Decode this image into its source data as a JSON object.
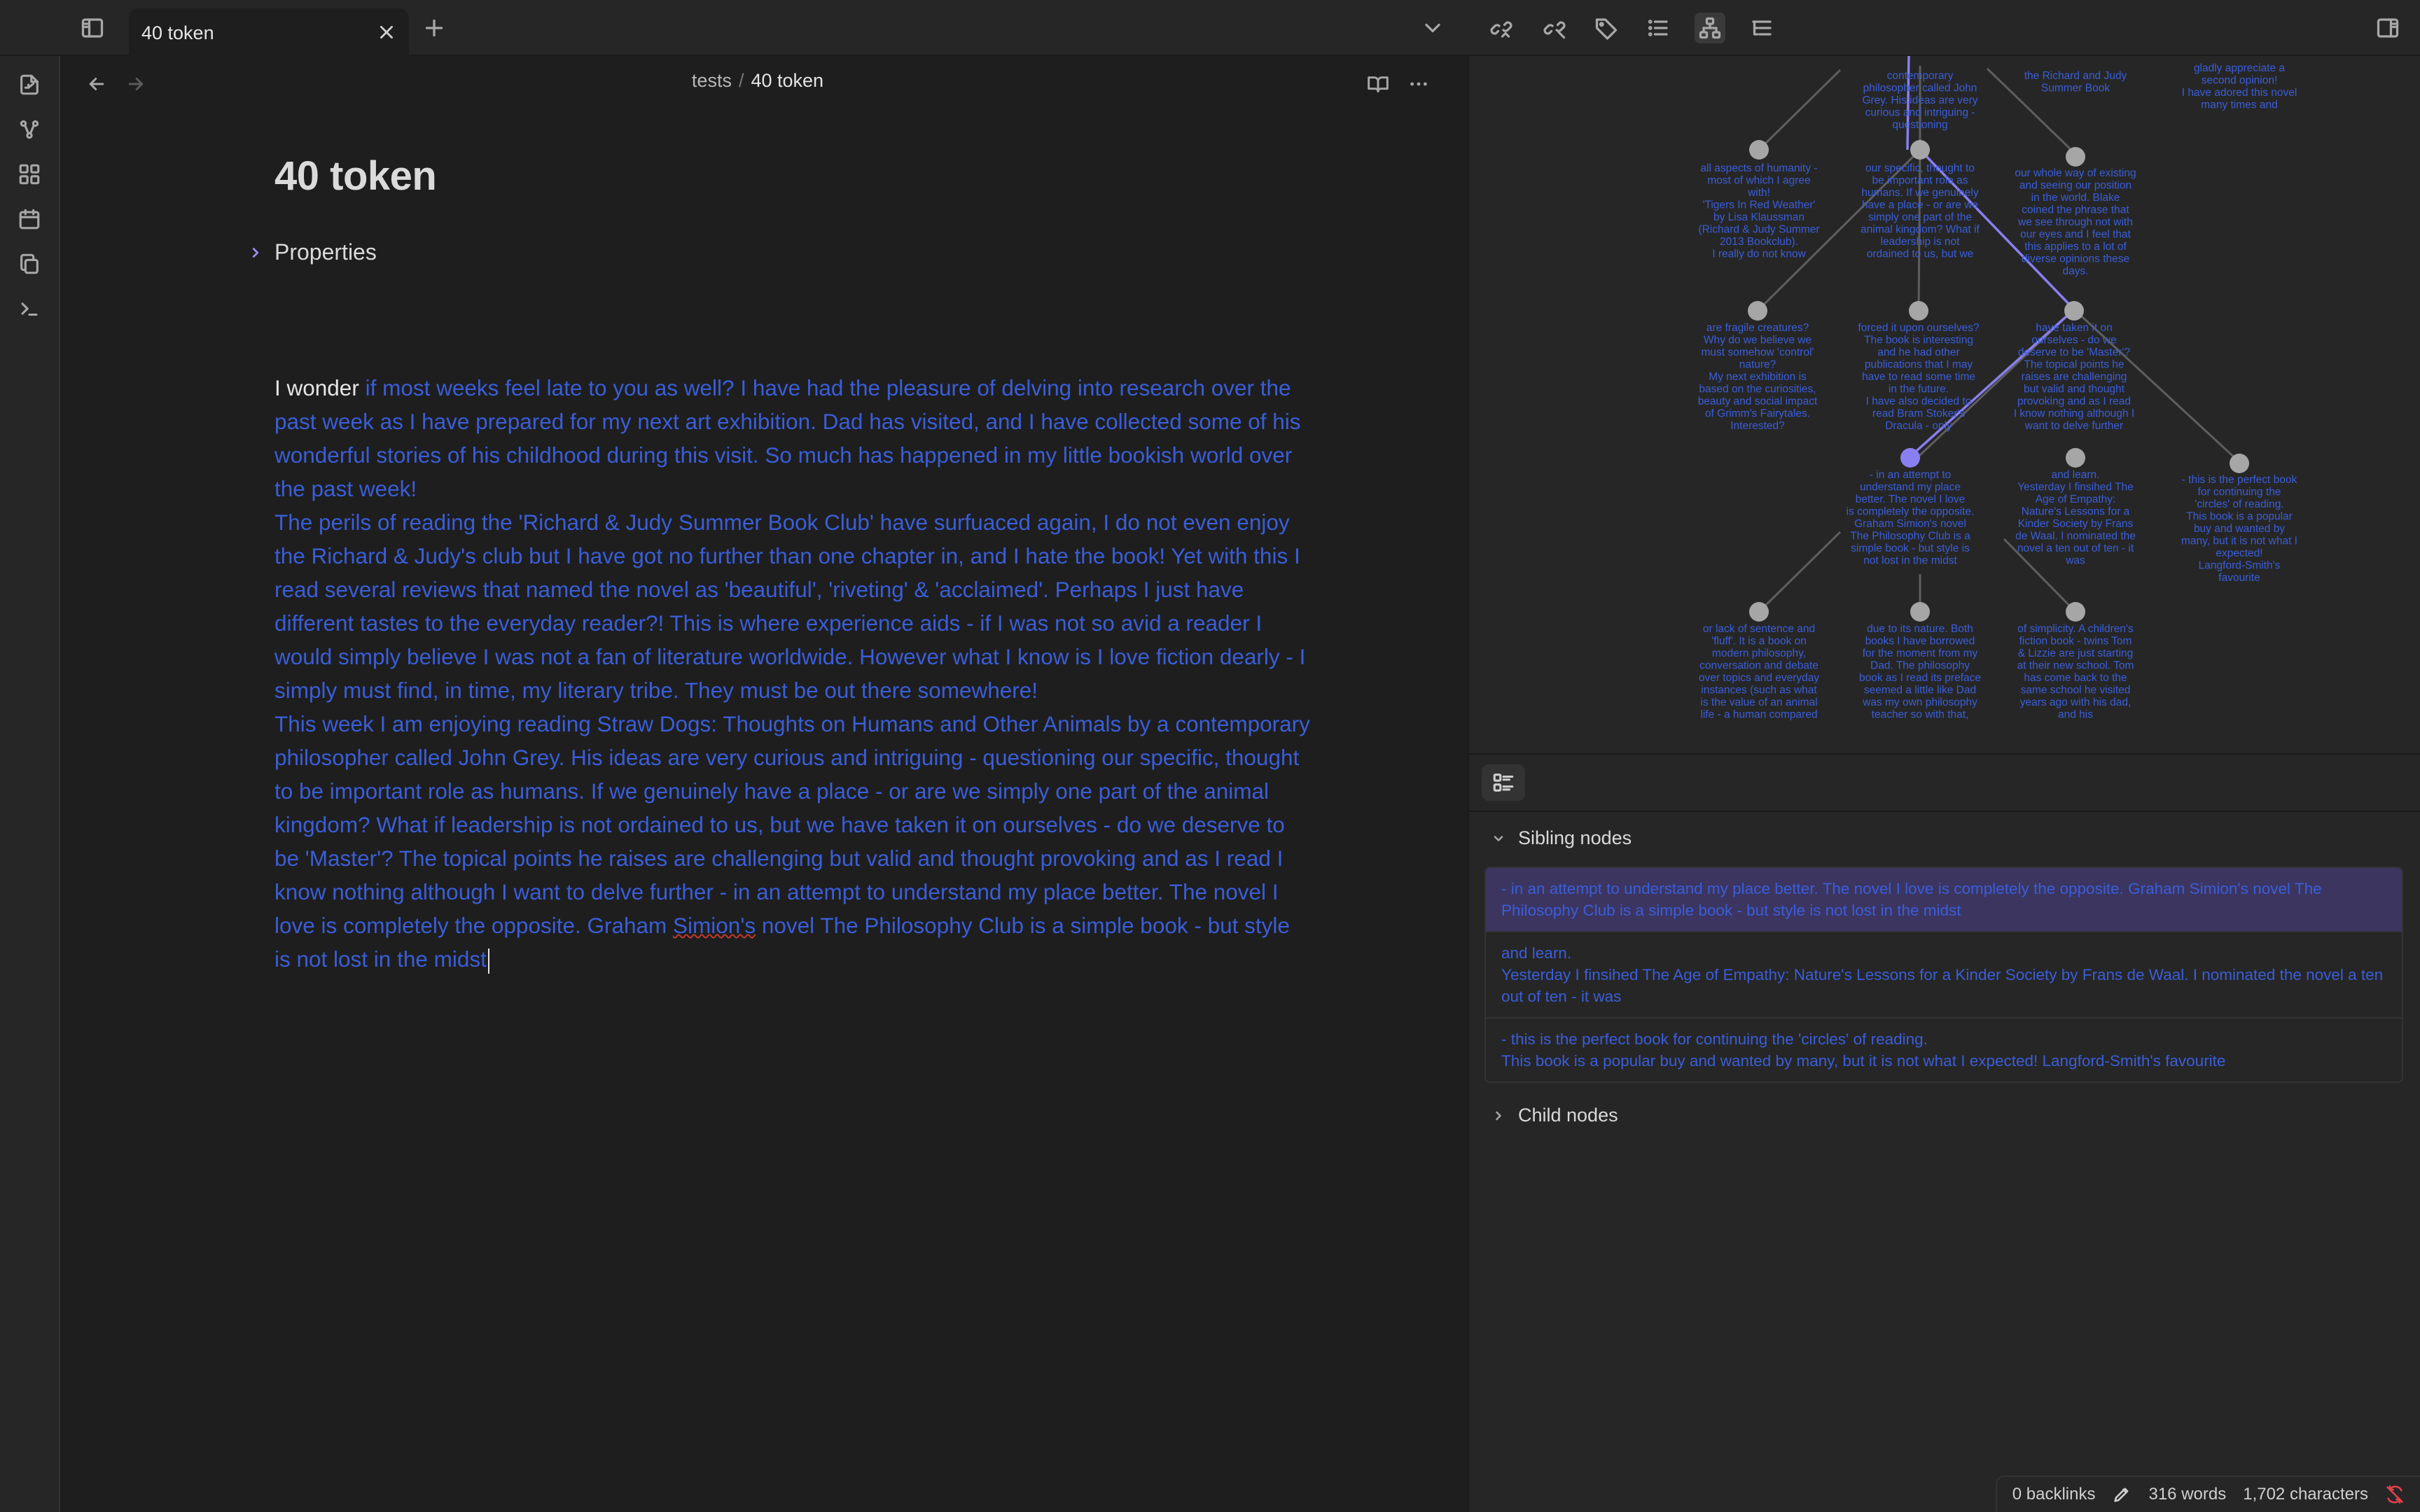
{
  "tab": {
    "title": "40 token"
  },
  "breadcrumb": {
    "folder": "tests",
    "separator": "/",
    "current": "40 token"
  },
  "document": {
    "title": "40 token",
    "properties_label": "Properties",
    "lead": "I wonder",
    "p1_rest": " if most weeks feel late to you as well? I have had the pleasure of delving into research over the past week as I have prepared for my next art exhibition. Dad has visited, and I have collected some of his wonderful stories of his childhood during this visit. So much has happened in my little bookish world over the past week!",
    "p2": "The perils of reading the 'Richard & Judy Summer Book Club' have surfuaced again, I do not even enjoy the Richard & Judy's club but I have got no further than one chapter in, and I hate the book! Yet with this I read several reviews that named the novel as 'beautiful', 'riveting' & 'acclaimed'. Perhaps I just have different tastes to the everyday reader?! This is where experience aids - if I was not so avid a reader I would simply believe I was not a fan of literature worldwide. However what I know is I love fiction dearly - I simply must find, in time, my literary tribe. They must be out there somewhere!",
    "p3_a": "This week I am enjoying reading Straw Dogs: Thoughts on Humans and Other Animals by a contemporary philosopher called John Grey. His ideas are very curious and intriguing - questioning our specific, thought to be important role as humans. If we genuinely have a place - or are we simply one part of the animal kingdom? What if leadership is not ordained to us, but we  have taken it on ourselves - do we deserve to be 'Master'? The topical points he raises are challenging but valid and thought provoking and as I read I know nothing although I want to delve further - in an attempt to understand my place better. The novel I love is completely the opposite. Graham ",
    "p3_misspelled": "Simion's",
    "p3_b": " novel The Philosophy Club is a simple book - but style is not lost in the midst"
  },
  "graph": {
    "labels": {
      "top_partial_1": "contemporary\nphilosopher called John\nGrey. His ideas are very\ncurious and intriguing -\nquestioning",
      "top_partial_2": "the Richard and Judy\nSummer Book",
      "top_partial_3": "gladly appreciate a\nsecond opinion!\nI have adored this novel\nmany times and",
      "l1_a": "all aspects of humanity -\nmost of which I agree\nwith!\n'Tigers In Red Weather'\nby Lisa Klaussman\n(Richard & Judy Summer\n2013 Bookclub).\nI really do not know",
      "l1_b": "our specific, thought to\nbe important role as\nhumans. If we genuinely\nhave a place - or are we\nsimply one part of the\nanimal kingdom? What if\nleadership is not\nordained to us, but we",
      "l1_c": "our whole way of existing\nand seeing our position\nin the world. Blake\ncoined the phrase that\nwe see through not with\nour eyes and I feel that\nthis applies to a lot of\ndiverse opinions these\ndays.",
      "l2_a": "are fragile creatures?\nWhy do we believe we\nmust somehow 'control'\nnature?\nMy next exhibition is\nbased on the curiosities,\nbeauty and social impact\nof Grimm's Fairytales.\nInterested?",
      "l2_b": "forced it upon ourselves?\nThe book is interesting\nand he had other\npublications that I may\nhave to read some time\nin the future.\nI have also decided to\nread Bram Stoker's\nDracula - only",
      "l2_c": "have taken it on\nourselves - do we\ndeserve to be 'Master'?\nThe topical points he\nraises are challenging\nbut valid and thought\nprovoking and as I read\nI know nothing although I\nwant to delve further",
      "l3_a": "- in an attempt to\nunderstand my place\nbetter. The novel I love\nis completely the opposite.\nGraham Simion's novel\nThe Philosophy Club is a\nsimple book - but style is\nnot lost in the midst",
      "l3_b": "and learn.\nYesterday I finsihed The\nAge of Empathy:\nNature's Lessons for a\nKinder Society by Frans\nde Waal. I nominated the\nnovel a ten out of ten - it\nwas",
      "l3_c": "- this is the perfect book\nfor continuing the\n'circles' of reading.\nThis book is a popular\nbuy and wanted by\nmany, but it is not what I\nexpected!\nLangford-Smith's\nfavourite",
      "l4_a": "or lack of sentence and\n'fluff'. It is a book on\nmodern philosophy,\nconversation and debate\nover topics and everyday\ninstances (such as what\nis the value of an animal\nlife - a human compared",
      "l4_b": "due to its nature. Both\nbooks I have borrowed\nfor the moment from my\nDad. The philosophy\nbook as I read its preface\nseemed a little like Dad\nwas my own philosophy\nteacher so with that,",
      "l4_c": "of simplicity. A children's\nfiction book - twins Tom\n& Lizzie are just starting\nat their new school. Tom\nhas come back to the\nsame school he visited\nyears ago with his dad,\nand his"
    }
  },
  "panel": {
    "sibling_heading": "Sibling nodes",
    "child_heading": "Child nodes",
    "siblings": [
      "- in an attempt to understand my place better. The novel I love is completely the opposite. Graham Simion's novel The Philosophy Club is a simple book - but style is not lost in the midst",
      "and learn.\nYesterday I finsihed The Age of Empathy: Nature's Lessons for a Kinder Society by Frans de Waal. I nominated the novel a ten out of ten - it was",
      "- this is the perfect book for continuing the 'circles' of reading.\nThis book is a popular buy and wanted by many, but it is not what I expected! Langford-Smith's favourite"
    ]
  },
  "status": {
    "backlinks": "0 backlinks",
    "words": "316 words",
    "characters": "1,702 characters"
  },
  "colors": {
    "accent": "#9a8cf0",
    "link_text": "#3a5ed9",
    "active_sibling_bg": "#3c3560",
    "sync_error": "#e0424b"
  }
}
